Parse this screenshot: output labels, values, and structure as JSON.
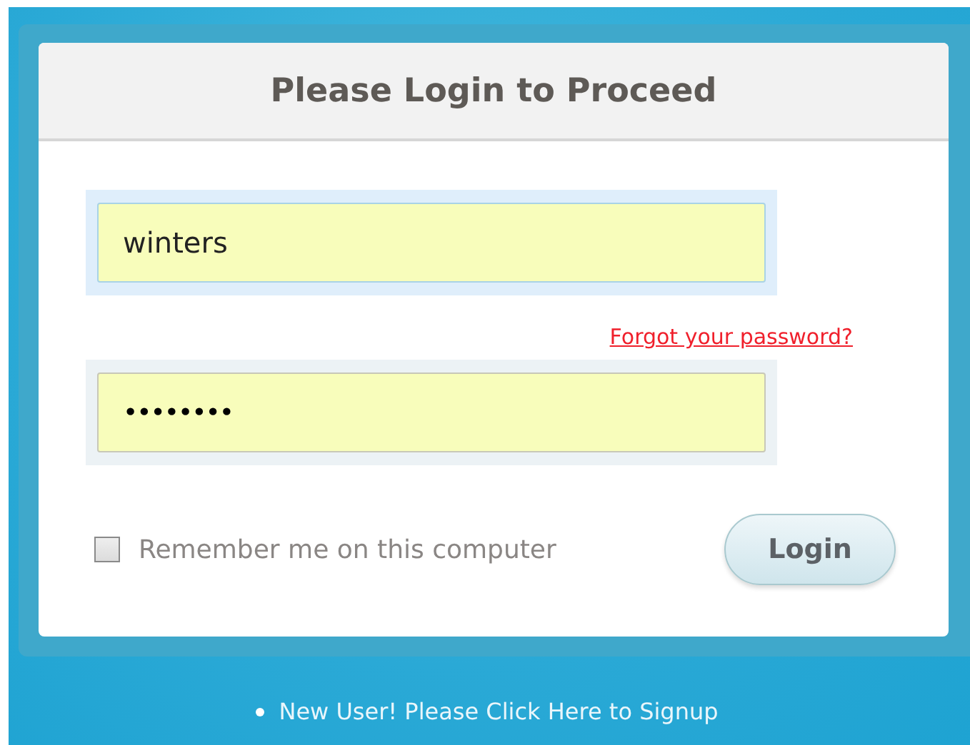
{
  "title": "Please Login to Proceed",
  "username": {
    "value": "winters"
  },
  "forgot_link": "Forgot your password?",
  "password": {
    "value": "••••••••"
  },
  "remember": {
    "label": "Remember me on this computer",
    "checked": false
  },
  "login_button": "Login",
  "signup_link": "New User! Please Click Here to Signup"
}
